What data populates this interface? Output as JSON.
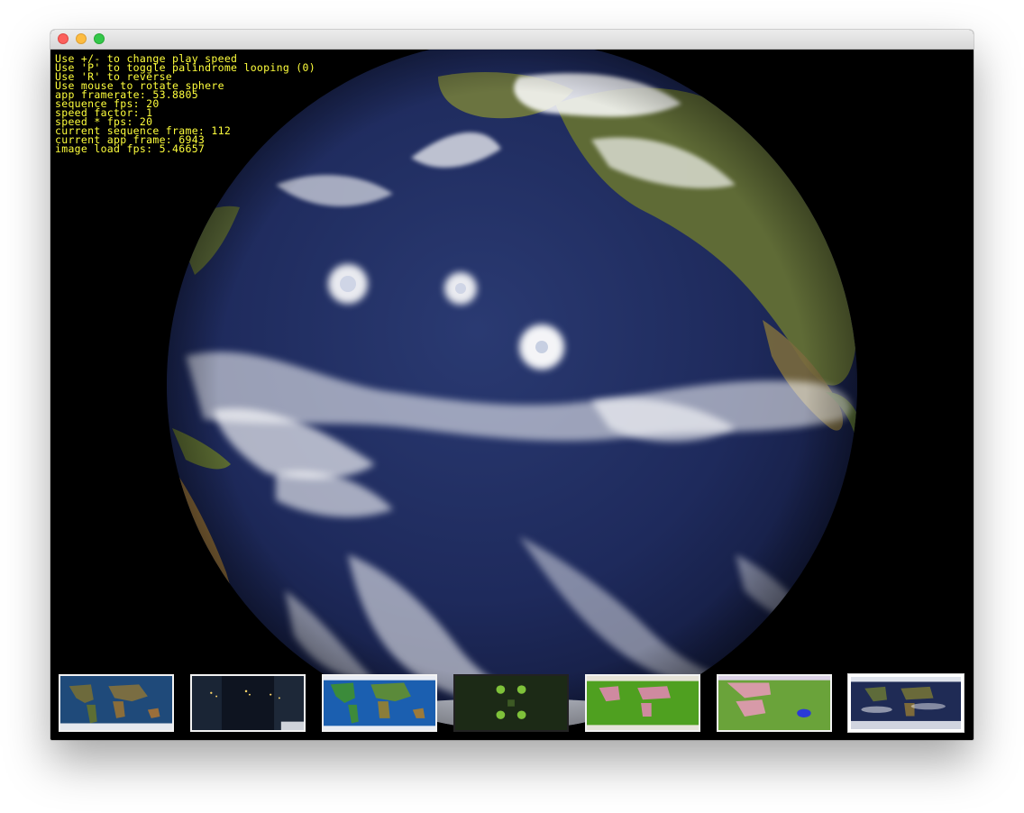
{
  "window": {
    "buttons": [
      "close",
      "minimize",
      "maximize"
    ]
  },
  "hud": {
    "color": "#ffff3c",
    "lines": [
      "Use +/- to change play speed",
      "Use 'P' to toggle palindrome looping (0)",
      "Use 'R' to reverse",
      "Use mouse to rotate sphere",
      "app framerate: 53.8805",
      "sequence fps: 20",
      "speed factor: 1",
      "speed * fps: 20",
      "current sequence frame: 112",
      "current app frame: 6943",
      "image load fps: 5.46657"
    ]
  },
  "globe": {
    "subject": "earth-globe",
    "ocean_color": "#1d2a5a",
    "land_color": "#5d6e3a",
    "cloud_color": "#ffffff"
  },
  "thumbnails": [
    {
      "name": "world-map-blue-marble",
      "selected": false
    },
    {
      "name": "world-map-night-lights",
      "selected": false
    },
    {
      "name": "world-map-topography",
      "selected": false
    },
    {
      "name": "green-pattern",
      "selected": false
    },
    {
      "name": "world-map-green-vegetation",
      "selected": false
    },
    {
      "name": "world-map-green-pink",
      "selected": false
    },
    {
      "name": "world-map-clouds",
      "selected": true
    }
  ]
}
